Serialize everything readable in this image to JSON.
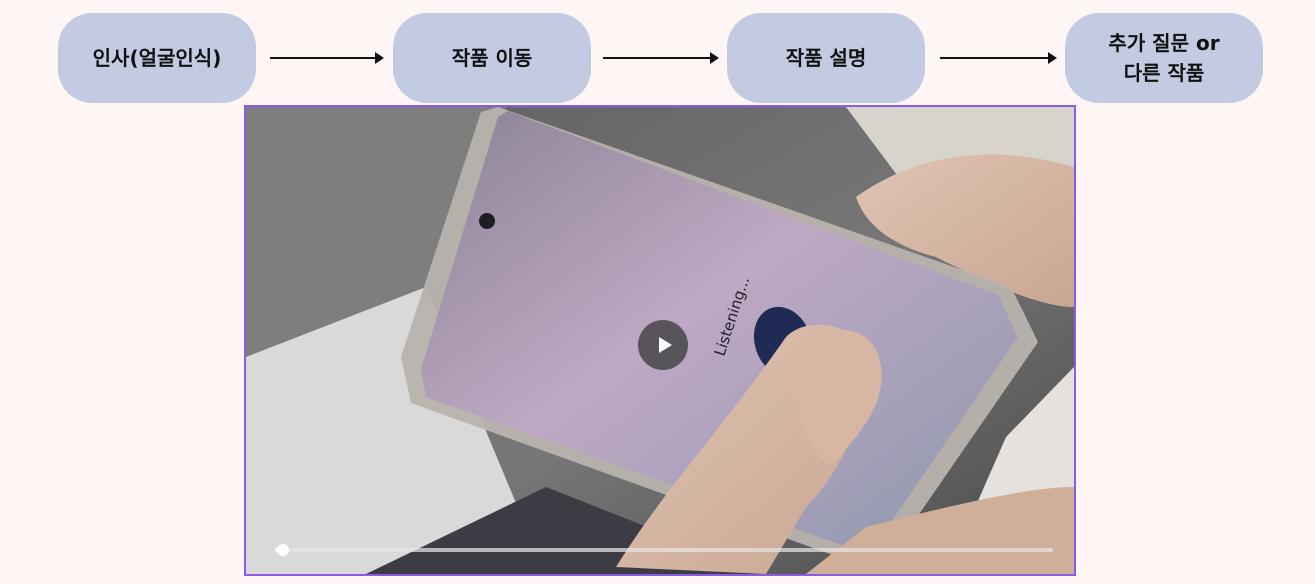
{
  "flow": {
    "steps": [
      {
        "label": "인사(얼굴인식)"
      },
      {
        "label": "작품 이동"
      },
      {
        "label": "작품 설명"
      },
      {
        "label": "추가 질문 or\n다른 작품"
      }
    ]
  },
  "video": {
    "phone_screen_text": "Listening...",
    "progress": 0.01,
    "controls": {
      "play_icon": "play-icon"
    }
  },
  "colors": {
    "page_background": "#fdf6f5",
    "step_fill": "#c3cbe3",
    "video_border": "#8a5ce6",
    "arrow": "#111111"
  }
}
